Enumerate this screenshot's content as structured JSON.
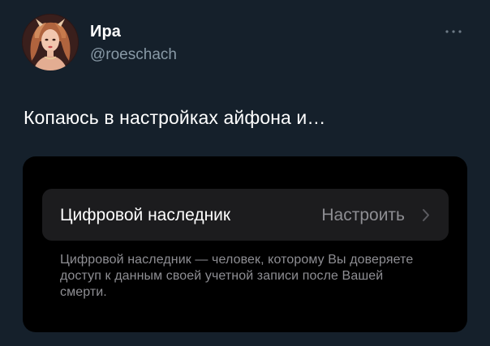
{
  "tweet": {
    "author_name": "Ира",
    "author_handle": "@roeschach",
    "text": "Копаюсь в настройках айфона и…"
  },
  "icons": {
    "avatar": "avatar-illustration",
    "more": "more-dots-icon",
    "chevron": "chevron-right-icon"
  },
  "media": {
    "row_title": "Цифровой наследник",
    "row_value": "Настроить",
    "footer_text": "Цифровой наследник — человек, которому Вы доверяете доступ к данным своей учетной записи после Вашей смерти."
  },
  "colors": {
    "background": "#15202b",
    "secondary_text": "#8899a6",
    "cell_background": "#1c1c1e",
    "ios_secondary_text": "#8e8e93"
  }
}
